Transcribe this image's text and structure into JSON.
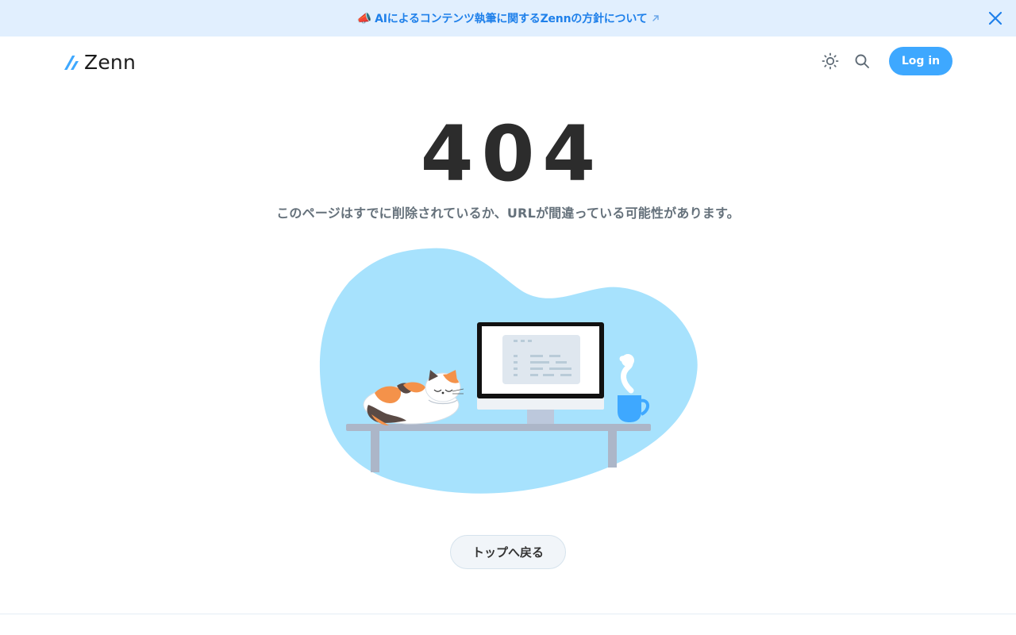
{
  "banner": {
    "emoji": "📣",
    "text": "AIによるコンテンツ執筆に関するZennの方針について",
    "close_icon": "close-icon",
    "accent": "#1f80ea",
    "background": "#e1effe"
  },
  "header": {
    "logo_text": "Zenn",
    "theme_icon": "sun-icon",
    "search_icon": "search-icon",
    "login_label": "Log in",
    "login_color": "#3ea8ff"
  },
  "main": {
    "error_code": "404",
    "message": "このページはすでに削除されているか、URLが間違っている可能性があります。",
    "illustration": "cat-sleeping-on-desk-illustration",
    "back_label": "トップへ戻る"
  }
}
